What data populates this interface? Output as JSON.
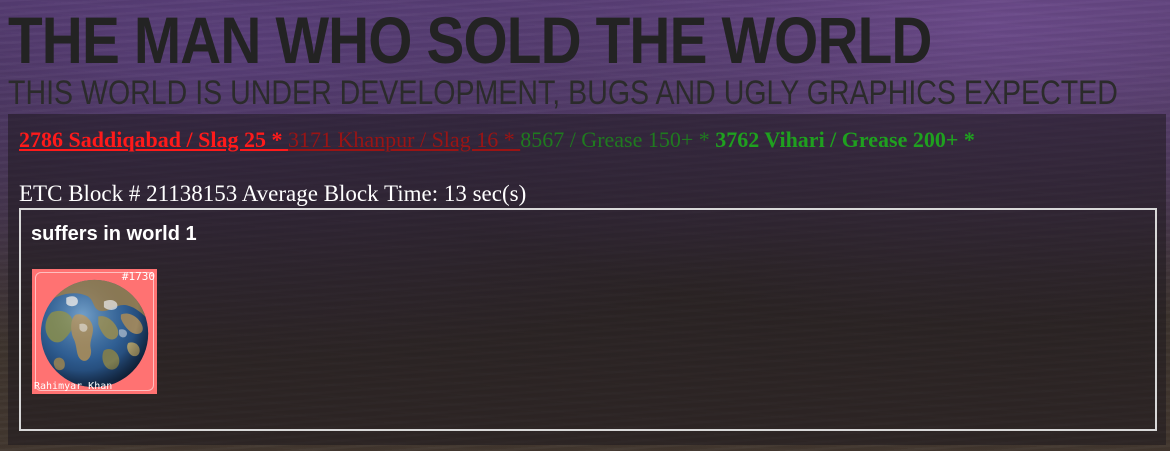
{
  "header": {
    "title": "THE MAN WHO SOLD THE WORLD",
    "subtitle": "THIS WORLD IS UNDER DEVELOPMENT, BUGS AND UGLY GRAPHICS EXPECTED"
  },
  "ticker": {
    "items": [
      {
        "text": "2786 Saddiqabad / Slag 25 * ",
        "style": "red-bold"
      },
      {
        "text": "3171 Khanpur / Slag 16 * ",
        "style": "red-dim"
      },
      {
        "text": "8567 / Grease 150+ * ",
        "style": "green-dim"
      },
      {
        "text": "3762 Vihari / Grease 200+ *",
        "style": "green-bold"
      }
    ]
  },
  "block_info": {
    "text": "ETC Block # 21138153 Average Block Time: 13 sec(s)"
  },
  "world": {
    "heading": "suffers in world 1",
    "cards": [
      {
        "id": "#1730",
        "name": "Rahimyar Khan",
        "background_color": "#ff7272"
      }
    ]
  },
  "colors": {
    "title": "#232323",
    "red_bold": "#ff1a1a",
    "red_dim": "#9a1414",
    "green_dim": "#1f7a1f",
    "green_bold": "#1fa01f",
    "box_border": "#d8d8d8"
  },
  "icons": {
    "globe": "planet-globe-icon"
  }
}
